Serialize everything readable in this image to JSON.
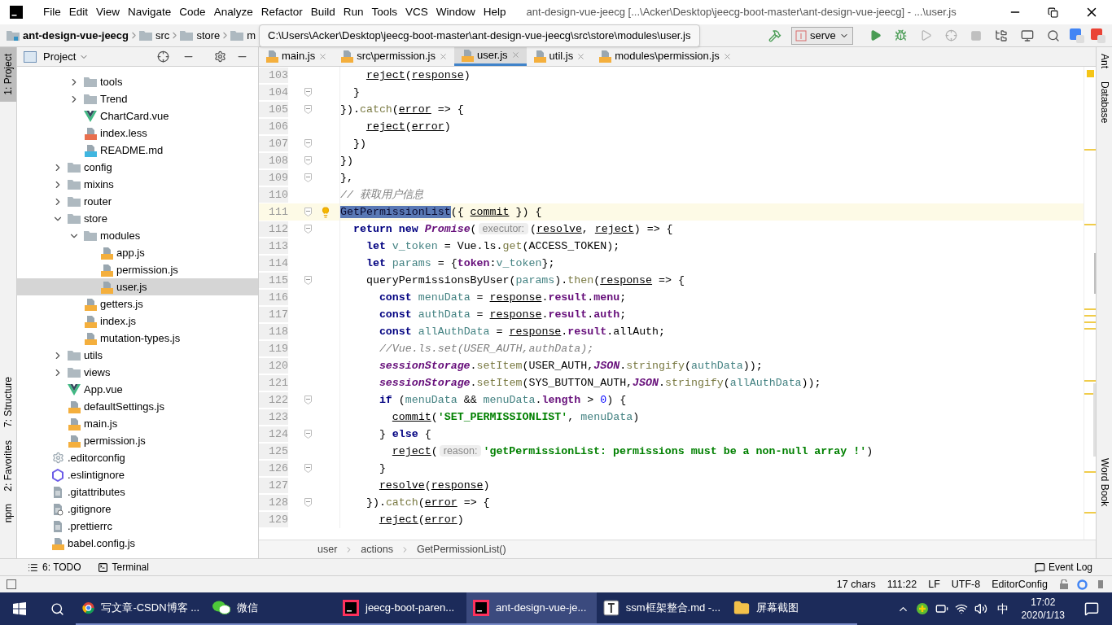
{
  "window": {
    "title": "ant-design-vue-jeecg [...\\Acker\\Desktop\\jeecg-boot-master\\ant-design-vue-jeecg] - ...\\user.js"
  },
  "menu": [
    "File",
    "Edit",
    "View",
    "Navigate",
    "Code",
    "Analyze",
    "Refactor",
    "Build",
    "Run",
    "Tools",
    "VCS",
    "Window",
    "Help"
  ],
  "nav_path": [
    "ant-design-vue-jeecg",
    "src",
    "store",
    "m"
  ],
  "path_tooltip": "C:\\Users\\Acker\\Desktop\\jeecg-boot-master\\ant-design-vue-jeecg\\src\\store\\modules\\user.js",
  "run_config": "serve",
  "left_strip": [
    {
      "label": "1: Project",
      "selected": true
    },
    {
      "label": "7: Structure",
      "selected": false
    },
    {
      "label": "2: Favorites",
      "selected": false
    },
    {
      "label": "npm",
      "selected": false
    }
  ],
  "right_strip": [
    "Ant",
    "Database",
    "Word Book"
  ],
  "project_panel": {
    "title": "Project",
    "tree": [
      {
        "children": [
          {
            "children": [
              {
                "name": "tools",
                "kind": "folder",
                "expanded": false,
                "selected": false
              },
              {
                "name": "Trend",
                "kind": "folder",
                "expanded": false,
                "selected": false
              },
              {
                "name": "ChartCard.vue",
                "kind": "vue",
                "selected": false
              },
              {
                "name": "index.less",
                "kind": "less",
                "selected": false
              },
              {
                "name": "README.md",
                "kind": "md",
                "selected": false
              }
            ]
          },
          {
            "name": "config",
            "kind": "folder",
            "expanded": false,
            "selected": false
          },
          {
            "name": "mixins",
            "kind": "folder",
            "expanded": false,
            "selected": false
          },
          {
            "name": "router",
            "kind": "folder",
            "expanded": false,
            "selected": false
          },
          {
            "name": "store",
            "kind": "folder",
            "expanded": true,
            "selected": false,
            "children": [
              {
                "name": "modules",
                "kind": "folder",
                "expanded": true,
                "selected": false,
                "children": [
                  {
                    "name": "app.js",
                    "kind": "js",
                    "selected": false
                  },
                  {
                    "name": "permission.js",
                    "kind": "js",
                    "selected": false
                  },
                  {
                    "name": "user.js",
                    "kind": "js",
                    "selected": true
                  }
                ]
              },
              {
                "name": "getters.js",
                "kind": "js",
                "selected": false
              },
              {
                "name": "index.js",
                "kind": "js",
                "selected": false
              },
              {
                "name": "mutation-types.js",
                "kind": "js",
                "selected": false
              }
            ]
          },
          {
            "name": "utils",
            "kind": "folder",
            "expanded": false,
            "selected": false
          },
          {
            "name": "views",
            "kind": "folder",
            "expanded": false,
            "selected": false
          },
          {
            "name": "App.vue",
            "kind": "vue",
            "selected": false
          },
          {
            "name": "defaultSettings.js",
            "kind": "js",
            "selected": false
          },
          {
            "name": "main.js",
            "kind": "js",
            "selected": false
          },
          {
            "name": "permission.js",
            "kind": "js",
            "selected": false
          }
        ]
      },
      {
        "name": ".editorconfig",
        "kind": "gear",
        "selected": false
      },
      {
        "name": ".eslintignore",
        "kind": "eslint",
        "selected": false
      },
      {
        "name": ".gitattributes",
        "kind": "text",
        "selected": false
      },
      {
        "name": ".gitignore",
        "kind": "ignore",
        "selected": false
      },
      {
        "name": ".prettierrc",
        "kind": "text",
        "selected": false
      },
      {
        "name": "babel.config.js",
        "kind": "js",
        "selected": false
      }
    ]
  },
  "tabs": [
    {
      "label": "main.js",
      "selected": false
    },
    {
      "label": "src\\permission.js",
      "selected": false
    },
    {
      "label": "user.js",
      "selected": true
    },
    {
      "label": "util.js",
      "selected": false
    },
    {
      "label": "modules\\permission.js",
      "selected": false
    }
  ],
  "editor": {
    "lines": [
      {
        "no": "103",
        "fold": false,
        "current": false,
        "tokens": [
          {
            "t": "    reject",
            "kind": "u"
          },
          {
            "t": "(",
            "kind": "p"
          },
          {
            "t": "response",
            "kind": "u"
          },
          {
            "t": ")",
            "kind": "p"
          }
        ]
      },
      {
        "no": "104",
        "fold": true,
        "current": false,
        "tokens": [
          {
            "t": "  }",
            "kind": "p"
          }
        ]
      },
      {
        "no": "105",
        "fold": true,
        "current": false,
        "tokens": [
          {
            "t": "}).",
            "kind": "p"
          },
          {
            "t": "catch",
            "kind": "m"
          },
          {
            "t": "(",
            "kind": "p"
          },
          {
            "t": "error",
            "kind": "u"
          },
          {
            "t": " => {",
            "kind": "p"
          }
        ]
      },
      {
        "no": "106",
        "fold": false,
        "current": false,
        "tokens": [
          {
            "t": "    reject",
            "kind": "u"
          },
          {
            "t": "(",
            "kind": "p"
          },
          {
            "t": "error",
            "kind": "u"
          },
          {
            "t": ")",
            "kind": "p"
          }
        ]
      },
      {
        "no": "107",
        "fold": true,
        "current": false,
        "tokens": [
          {
            "t": "  })",
            "kind": "p"
          }
        ]
      },
      {
        "no": "108",
        "fold": true,
        "current": false,
        "tokens": [
          {
            "t": "})",
            "kind": "p"
          }
        ]
      },
      {
        "no": "109",
        "fold": true,
        "current": false,
        "tokens": [
          {
            "t": "},",
            "kind": "p"
          }
        ]
      },
      {
        "no": "110",
        "fold": false,
        "current": false,
        "tokens": [
          {
            "t": "// 获取用户信息",
            "kind": "c"
          }
        ]
      },
      {
        "no": "111",
        "fold": true,
        "current": true,
        "tokens": [
          {
            "t": "GetPermissionList",
            "kind": "sel"
          },
          {
            "t": "({ ",
            "kind": "p"
          },
          {
            "t": "commit",
            "kind": "u"
          },
          {
            "t": " }) {",
            "kind": "p"
          }
        ]
      },
      {
        "no": "112",
        "fold": true,
        "current": false,
        "tokens": [
          {
            "t": "  return new ",
            "kind": "kw"
          },
          {
            "t": "Promise",
            "kind": "g"
          },
          {
            "t": "(",
            "kind": "p"
          },
          {
            "t": "executor:",
            "kind": "hint"
          },
          {
            "t": "(",
            "kind": "p"
          },
          {
            "t": "resolve",
            "kind": "u"
          },
          {
            "t": ", ",
            "kind": "p"
          },
          {
            "t": "reject",
            "kind": "u"
          },
          {
            "t": ") => {",
            "kind": "p"
          }
        ]
      },
      {
        "no": "113",
        "fold": false,
        "current": false,
        "tokens": [
          {
            "t": "    let ",
            "kind": "kw"
          },
          {
            "t": "v_token",
            "kind": "v"
          },
          {
            "t": " = Vue.ls.",
            "kind": "p"
          },
          {
            "t": "get",
            "kind": "m"
          },
          {
            "t": "(ACCESS_TOKEN);",
            "kind": "p"
          }
        ]
      },
      {
        "no": "114",
        "fold": false,
        "current": false,
        "tokens": [
          {
            "t": "    let ",
            "kind": "kw"
          },
          {
            "t": "params",
            "kind": "v"
          },
          {
            "t": " = {",
            "kind": "p"
          },
          {
            "t": "token",
            "kind": "f"
          },
          {
            "t": ":",
            "kind": "p"
          },
          {
            "t": "v_token",
            "kind": "v"
          },
          {
            "t": "};",
            "kind": "p"
          }
        ]
      },
      {
        "no": "115",
        "fold": true,
        "current": false,
        "tokens": [
          {
            "t": "    queryPermissionsByUser(",
            "kind": "p"
          },
          {
            "t": "params",
            "kind": "v"
          },
          {
            "t": ").",
            "kind": "p"
          },
          {
            "t": "then",
            "kind": "m"
          },
          {
            "t": "(",
            "kind": "p"
          },
          {
            "t": "response",
            "kind": "u"
          },
          {
            "t": " => {",
            "kind": "p"
          }
        ]
      },
      {
        "no": "116",
        "fold": false,
        "current": false,
        "tokens": [
          {
            "t": "      const ",
            "kind": "kw"
          },
          {
            "t": "menuData",
            "kind": "v"
          },
          {
            "t": " = ",
            "kind": "p"
          },
          {
            "t": "response",
            "kind": "u"
          },
          {
            "t": ".",
            "kind": "p"
          },
          {
            "t": "result",
            "kind": "f"
          },
          {
            "t": ".",
            "kind": "p"
          },
          {
            "t": "menu",
            "kind": "f"
          },
          {
            "t": ";",
            "kind": "p"
          }
        ]
      },
      {
        "no": "117",
        "fold": false,
        "current": false,
        "tokens": [
          {
            "t": "      const ",
            "kind": "kw"
          },
          {
            "t": "authData",
            "kind": "v"
          },
          {
            "t": " = ",
            "kind": "p"
          },
          {
            "t": "response",
            "kind": "u"
          },
          {
            "t": ".",
            "kind": "p"
          },
          {
            "t": "result",
            "kind": "f"
          },
          {
            "t": ".",
            "kind": "p"
          },
          {
            "t": "auth",
            "kind": "f"
          },
          {
            "t": ";",
            "kind": "p"
          }
        ]
      },
      {
        "no": "118",
        "fold": false,
        "current": false,
        "tokens": [
          {
            "t": "      const ",
            "kind": "kw"
          },
          {
            "t": "allAuthData",
            "kind": "v"
          },
          {
            "t": " = ",
            "kind": "p"
          },
          {
            "t": "response",
            "kind": "u"
          },
          {
            "t": ".",
            "kind": "p"
          },
          {
            "t": "result",
            "kind": "f"
          },
          {
            "t": ".allAuth;",
            "kind": "p"
          }
        ]
      },
      {
        "no": "119",
        "fold": false,
        "current": false,
        "tokens": [
          {
            "t": "      //Vue.ls.set(USER_AUTH,authData);",
            "kind": "c"
          }
        ]
      },
      {
        "no": "120",
        "fold": false,
        "current": false,
        "tokens": [
          {
            "t": "      sessionStorage",
            "kind": "g"
          },
          {
            "t": ".",
            "kind": "p"
          },
          {
            "t": "setItem",
            "kind": "m"
          },
          {
            "t": "(USER_AUTH,",
            "kind": "p"
          },
          {
            "t": "JSON",
            "kind": "g"
          },
          {
            "t": ".",
            "kind": "p"
          },
          {
            "t": "stringify",
            "kind": "m"
          },
          {
            "t": "(",
            "kind": "p"
          },
          {
            "t": "authData",
            "kind": "v"
          },
          {
            "t": "));",
            "kind": "p"
          }
        ]
      },
      {
        "no": "121",
        "fold": false,
        "current": false,
        "tokens": [
          {
            "t": "      sessionStorage",
            "kind": "g"
          },
          {
            "t": ".",
            "kind": "p"
          },
          {
            "t": "setItem",
            "kind": "m"
          },
          {
            "t": "(SYS_BUTTON_AUTH,",
            "kind": "p"
          },
          {
            "t": "JSON",
            "kind": "g"
          },
          {
            "t": ".",
            "kind": "p"
          },
          {
            "t": "stringify",
            "kind": "m"
          },
          {
            "t": "(",
            "kind": "p"
          },
          {
            "t": "allAuthData",
            "kind": "v"
          },
          {
            "t": "));",
            "kind": "p"
          }
        ]
      },
      {
        "no": "122",
        "fold": true,
        "current": false,
        "tokens": [
          {
            "t": "      if",
            "kind": "kw"
          },
          {
            "t": " (",
            "kind": "p"
          },
          {
            "t": "menuData",
            "kind": "v"
          },
          {
            "t": " && ",
            "kind": "p"
          },
          {
            "t": "menuData",
            "kind": "v"
          },
          {
            "t": ".",
            "kind": "p"
          },
          {
            "t": "length",
            "kind": "f"
          },
          {
            "t": " > ",
            "kind": "p"
          },
          {
            "t": "0",
            "kind": "n"
          },
          {
            "t": ") {",
            "kind": "p"
          }
        ]
      },
      {
        "no": "123",
        "fold": false,
        "current": false,
        "tokens": [
          {
            "t": "        commit",
            "kind": "u"
          },
          {
            "t": "(",
            "kind": "p"
          },
          {
            "t": "'SET_PERMISSIONLIST'",
            "kind": "s"
          },
          {
            "t": ", ",
            "kind": "p"
          },
          {
            "t": "menuData",
            "kind": "v"
          },
          {
            "t": ")",
            "kind": "p"
          }
        ]
      },
      {
        "no": "124",
        "fold": true,
        "current": false,
        "tokens": [
          {
            "t": "      } ",
            "kind": "p"
          },
          {
            "t": "else",
            "kind": "kw"
          },
          {
            "t": " {",
            "kind": "p"
          }
        ]
      },
      {
        "no": "125",
        "fold": false,
        "current": false,
        "tokens": [
          {
            "t": "        reject",
            "kind": "u"
          },
          {
            "t": "(",
            "kind": "p"
          },
          {
            "t": "reason:",
            "kind": "hint"
          },
          {
            "t": "'getPermissionList: permissions must be a non-null array !'",
            "kind": "s"
          },
          {
            "t": ")",
            "kind": "p"
          }
        ]
      },
      {
        "no": "126",
        "fold": true,
        "current": false,
        "tokens": [
          {
            "t": "      }",
            "kind": "p"
          }
        ]
      },
      {
        "no": "127",
        "fold": false,
        "current": false,
        "tokens": [
          {
            "t": "      resolve",
            "kind": "u"
          },
          {
            "t": "(",
            "kind": "p"
          },
          {
            "t": "response",
            "kind": "u"
          },
          {
            "t": ")",
            "kind": "p"
          }
        ]
      },
      {
        "no": "128",
        "fold": true,
        "current": false,
        "tokens": [
          {
            "t": "    }).",
            "kind": "p"
          },
          {
            "t": "catch",
            "kind": "m"
          },
          {
            "t": "(",
            "kind": "p"
          },
          {
            "t": "error",
            "kind": "u"
          },
          {
            "t": " => {",
            "kind": "p"
          }
        ]
      },
      {
        "no": "129",
        "fold": false,
        "current": false,
        "tokens": [
          {
            "t": "      reject",
            "kind": "u"
          },
          {
            "t": "(",
            "kind": "p"
          },
          {
            "t": "error",
            "kind": "u"
          },
          {
            "t": ")",
            "kind": "p"
          }
        ]
      }
    ],
    "breadcrumb": [
      "user",
      "actions",
      "GetPermissionList()"
    ]
  },
  "bottom_tools": [
    "6: TODO",
    "Terminal"
  ],
  "event_log": "Event Log",
  "status_bar": [
    "17 chars",
    "111:22",
    "LF",
    "UTF-8",
    "EditorConfig"
  ],
  "taskbar": {
    "apps": [
      {
        "label": "写文章-CSDN博客 ...",
        "kind": "browser",
        "selected": false
      },
      {
        "label": "微信",
        "kind": "chat",
        "selected": false
      },
      {
        "label": "jeecg-boot-paren...",
        "kind": "ide",
        "selected": false
      },
      {
        "label": "ant-design-vue-je...",
        "kind": "ide",
        "selected": true
      },
      {
        "label": "ssm框架整合.md -...",
        "kind": "editor",
        "selected": false
      },
      {
        "label": "屏幕截图",
        "kind": "folder",
        "selected": false
      }
    ],
    "ime": "中",
    "time": "17:02",
    "date": "2020/1/13"
  }
}
